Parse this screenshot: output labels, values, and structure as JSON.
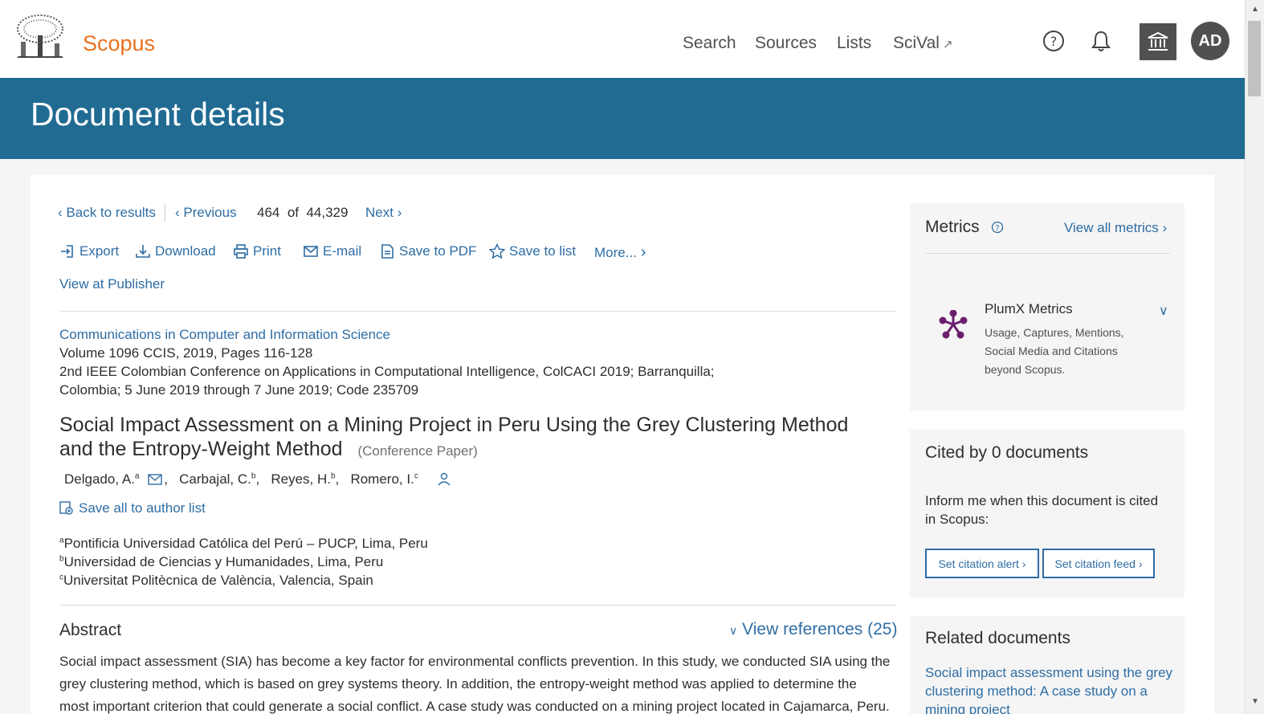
{
  "header": {
    "brand": "Scopus",
    "nav": {
      "search": "Search",
      "sources": "Sources",
      "lists": "Lists",
      "scival": "SciVal"
    },
    "avatar_initials": "AD"
  },
  "banner_title": "Document details",
  "pager": {
    "back": "Back to results",
    "previous": "Previous",
    "current": "464",
    "of": "of",
    "total": "44,329",
    "next": "Next"
  },
  "toolbar": {
    "export": "Export",
    "download": "Download",
    "print": "Print",
    "email": "E-mail",
    "save_pdf": "Save to PDF",
    "save_list": "Save to list",
    "more": "More..."
  },
  "view_publisher": "View at Publisher",
  "source": {
    "journal": "Communications in Computer and Information Science",
    "volume": "Volume 1096 CCIS, 2019, Pages 116-128",
    "conference_line1": "2nd IEEE Colombian Conference on Applications in Computational Intelligence, ColCACI 2019; Barranquilla;",
    "conference_line2": "Colombia; 5 June 2019 through 7 June 2019; Code 235709"
  },
  "paper": {
    "title_line1": "Social Impact Assessment on a Mining Project in Peru Using the Grey Clustering Method",
    "title_line2": "and the Entropy-Weight Method",
    "type": "(Conference Paper)"
  },
  "authors": [
    {
      "name": "Delgado, A.",
      "sup": "a"
    },
    {
      "name": "Carbajal, C.",
      "sup": "b"
    },
    {
      "name": "Reyes, H.",
      "sup": "b"
    },
    {
      "name": "Romero, I.",
      "sup": "c"
    }
  ],
  "save_authors": "Save all to author list",
  "affiliations": [
    {
      "sup": "a",
      "text": "Pontificia Universidad Católica del Perú – PUCP, Lima, Peru"
    },
    {
      "sup": "b",
      "text": "Universidad de Ciencias y Humanidades, Lima, Peru"
    },
    {
      "sup": "c",
      "text": "Universitat Politècnica de València, Valencia, Spain"
    }
  ],
  "abstract": {
    "heading": "Abstract",
    "view_refs": "View references (25)",
    "line1": "Social impact assessment (SIA) has become a key factor for environmental conflicts prevention. In this study, we conducted SIA using the",
    "line2": "grey clustering method, which is based on grey systems theory. In addition, the entropy-weight method was applied to determine the",
    "line3": "most important criterion that could generate a social conflict. A case study was conducted on a mining project located in Cajamarca, Peru."
  },
  "metrics": {
    "title": "Metrics",
    "view_all": "View all metrics",
    "plumx_title": "PlumX Metrics",
    "plumx_line1": "Usage, Captures, Mentions,",
    "plumx_line2": "Social Media and Citations",
    "plumx_line3": "beyond Scopus."
  },
  "cited": {
    "title": "Cited by 0 documents",
    "inform_line1": "Inform me when this document is cited",
    "inform_line2": "in Scopus:",
    "alert_btn": "Set citation alert",
    "feed_btn": "Set citation feed"
  },
  "related": {
    "title": "Related documents",
    "link_line1": "Social impact assessment using the grey",
    "link_line2": "clustering method: A case study on a",
    "link_line3": "mining project"
  },
  "colors": {
    "accent": "#2e6da4",
    "banner": "#216b93",
    "brand": "#e9711c",
    "plumx": "#6b1f6e"
  }
}
